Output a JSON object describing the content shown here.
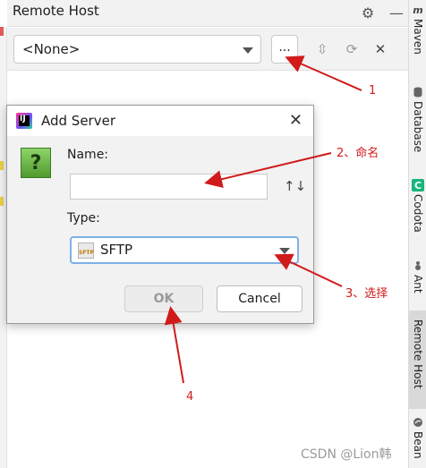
{
  "panel": {
    "title": "Remote Host",
    "selector_value": "<None>",
    "more_button_label": "..."
  },
  "right_bar": {
    "items": [
      {
        "label": "Maven",
        "icon": "m-icon",
        "glyph": "m",
        "color": "#444444"
      },
      {
        "label": "Database",
        "icon": "database-icon",
        "glyph": "",
        "color": "#555555"
      },
      {
        "label": "Codota",
        "icon": "codota-icon",
        "glyph": "C",
        "color": "#18b57a"
      },
      {
        "label": "Ant",
        "icon": "ant-icon",
        "glyph": "",
        "color": "#555555"
      },
      {
        "label": "Remote Host",
        "icon": "",
        "glyph": "",
        "color": "#555555"
      },
      {
        "label": "Bean",
        "icon": "bean-icon",
        "glyph": "",
        "color": "#555555"
      }
    ]
  },
  "dialog": {
    "title": "Add Server",
    "name_label": "Name:",
    "name_value": "",
    "type_label": "Type:",
    "type_value": "SFTP",
    "type_icon_text": "SFTP",
    "ok_label": "OK",
    "cancel_label": "Cancel"
  },
  "annotations": {
    "a1": "1",
    "a2": "2、命名",
    "a3": "3、选择",
    "a4": "4"
  },
  "watermark": "CSDN @Lion韩",
  "colors": {
    "annotation": "#d11a1a",
    "focus_border": "#7eb0e8"
  }
}
